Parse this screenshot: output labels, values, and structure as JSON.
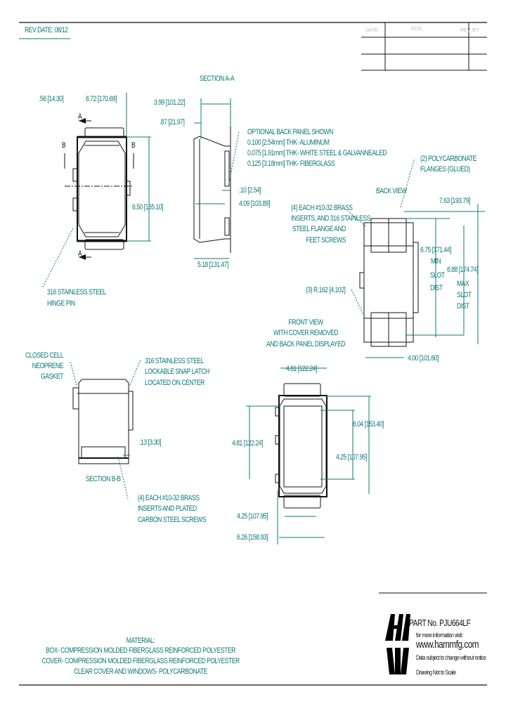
{
  "header": {
    "rev_date": "REV DATE: 08/12",
    "rev_table": {
      "columns": [
        "DATE",
        "REV",
        "ECN",
        "BY"
      ],
      "rows": [
        [
          "",
          "",
          "",
          ""
        ],
        [
          "",
          "",
          "",
          ""
        ]
      ]
    }
  },
  "colors": {
    "dimension": "#0b7a78",
    "outline": "#111111"
  },
  "views": {
    "section_aa_title": "SECTION A-A",
    "section_bb_title": "SECTION B-B",
    "back_view_title": "BACK VIEW",
    "front_view_title": [
      "FRONT VIEW",
      "WITH COVER REMOVED",
      "AND BACK PANEL DISPLAYED"
    ],
    "section_marks": {
      "a": "A",
      "b": "B"
    }
  },
  "dimensions": {
    "d056": ".56 [14.30]",
    "d672": "6.72 [170.69]",
    "d399": "3.99 [101.22]",
    "d087": ".87 [21.97]",
    "d650": "6.50 [165.10]",
    "d010": ".10 [2.54]",
    "d409": "4.09 [103.89]",
    "d518": "5.18 [131.47]",
    "d763": "7.63 [193.79]",
    "d675": "6.75 [171.44]",
    "min_slot": [
      "MIN",
      "SLOT",
      "DIST"
    ],
    "d688": "6.88 [174.74]",
    "max_slot": [
      "MAX",
      "SLOT",
      "DIST"
    ],
    "d400": "4.00 [101.60]",
    "radius": "(3) R.162 [4.102]",
    "d481top": "4.81 [122.24]",
    "d481side": "4.81 [122.24]",
    "d604": "6.04 [153.40]",
    "d425v": "4.25 [107.95]",
    "d425h": "4.25 [107.95]",
    "d626": "6.26 [158.93]",
    "d013": ".13 [3.30]"
  },
  "callouts": {
    "back_panel": [
      "OPTIONAL BACK PANEL SHOWN",
      "0.100 [2.54mm] THK- ALUMINUM",
      "0.075 [1.91mm] THK- WHITE STEEL & GALVANNEALED",
      "0.125 [3.18mm] THK- FIBERGLASS"
    ],
    "polycarbonate": [
      "(2) POLYCARBONATE",
      "FLANGES (GLUED)"
    ],
    "brass_inserts_flange": [
      "(4) EACH #10-32 BRASS",
      "INSERTS, AND 316 STAINLESS",
      "STEEL FLANGE AND",
      "FEET SCREWS"
    ],
    "hinge_pin": [
      "316 STAINLESS STEEL",
      "HINGE PIN"
    ],
    "gasket": [
      "CLOSED CELL",
      "NEOPRENE",
      "GASKET"
    ],
    "snap_latch": [
      "316 STAINLESS STEEL",
      "LOCKABLE SNAP LATCH",
      "LOCATED ON CENTER"
    ],
    "brass_inserts_screws": [
      "(4) EACH #10-32 BRASS",
      "INSERTS AND PLATED",
      "CARBON STEEL SCREWS"
    ]
  },
  "material": {
    "title": "MATERIAL:",
    "lines": [
      "BOX- COMPRESSION MOLDED FIBERGLASS REINFORCED POLYESTER",
      "COVER- COMPRESSION MOLDED FIBERGLASS REINFORCED POLYESTER",
      "CLEAR COVER AND WINDOWS- POLYCARBONATE"
    ]
  },
  "title_block": {
    "logo_top": "H",
    "logo_bottom": "W",
    "part_no": "PART No. PJU664LF",
    "info": "for more information visit:",
    "website": "www.hammfg.com",
    "disclaimer": "Data subject to change without notice",
    "scale_note": "Drawing Not to Scale"
  }
}
